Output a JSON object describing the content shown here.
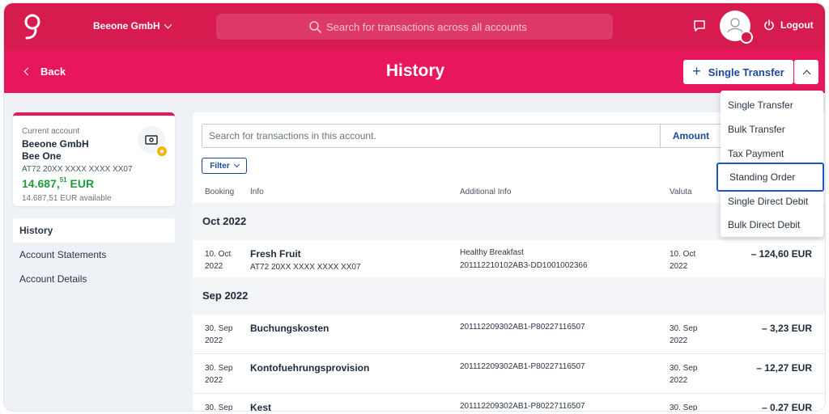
{
  "topbar": {
    "company": "Beeone GmbH",
    "search_placeholder": "Search for transactions across all accounts",
    "logout_label": "Logout"
  },
  "header": {
    "back_label": "Back",
    "title": "History",
    "single_transfer_label": "Single Transfer"
  },
  "account": {
    "label": "Current account",
    "name_line1": "Beeone GmbH",
    "name_line2": "Bee One",
    "iban": "AT72 20XX XXXX XXXX XX07",
    "balance_main": "14.687,",
    "balance_cents": "51",
    "balance_currency": "EUR",
    "available": "14.687,51 EUR available"
  },
  "sidebar": {
    "items": [
      {
        "label": "History"
      },
      {
        "label": "Account Statements"
      },
      {
        "label": "Account Details"
      }
    ]
  },
  "main": {
    "search_placeholder": "Search for transactions in this account.",
    "amount_label": "Amount",
    "filter_label": "Filter",
    "columns": {
      "booking": "Booking",
      "info": "Info",
      "additional": "Additional Info",
      "valuta": "Valuta"
    },
    "months": [
      "Oct 2022",
      "Sep 2022"
    ],
    "rows": [
      {
        "date1": "10. Oct",
        "date2": "2022",
        "info": "Fresh Fruit",
        "sub": "AT72 20XX XXXX XXXX XX07",
        "add1": "Healthy Breakfast",
        "add2": "201112210102AB3-DD1001002366",
        "val1": "10. Oct",
        "val2": "2022",
        "amount": "– 124,60 EUR"
      },
      {
        "date1": "30. Sep",
        "date2": "2022",
        "info": "Buchungskosten",
        "sub": "",
        "add1": "201112209302AB1-P80227116507",
        "add2": "",
        "val1": "30. Sep",
        "val2": "2022",
        "amount": "– 3,23 EUR"
      },
      {
        "date1": "30. Sep",
        "date2": "2022",
        "info": "Kontofuehrungsprovision",
        "sub": "",
        "add1": "201112209302AB1-P80227116507",
        "add2": "",
        "val1": "30. Sep",
        "val2": "2022",
        "amount": "– 12,27 EUR"
      },
      {
        "date1": "30. Sep",
        "date2": "",
        "info": "Kest",
        "sub": "",
        "add1": "201112209302AB1-P80227116507",
        "add2": "",
        "val1": "30. Sep",
        "val2": "",
        "amount": "– 0,27 EUR"
      }
    ]
  },
  "dropdown": {
    "items": [
      {
        "label": "Single Transfer"
      },
      {
        "label": "Bulk Transfer"
      },
      {
        "label": "Tax Payment"
      },
      {
        "label": "Standing Order"
      },
      {
        "label": "Single Direct Debit"
      },
      {
        "label": "Bulk Direct Debit"
      }
    ]
  },
  "colors": {
    "topbar": "#d81b4f",
    "headbar": "#e8175b",
    "accent_blue": "#1b4a9c",
    "balance_green": "#1f9d3a"
  }
}
